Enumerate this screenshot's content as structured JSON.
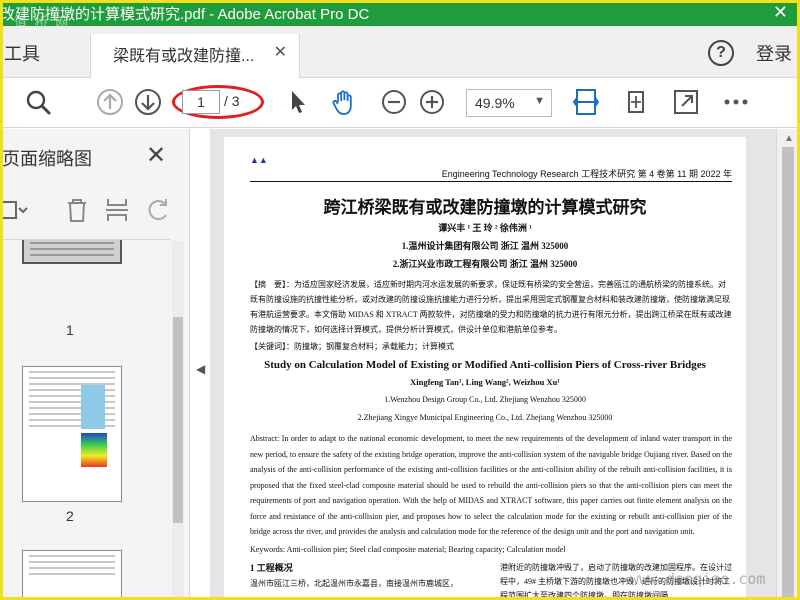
{
  "window": {
    "title": "改建防撞墩的计算模式研究.pdf - Adobe Acrobat Pro DC",
    "watermark": "道 桥 网"
  },
  "tabs": {
    "tools_label": "工具",
    "doc_tab_label": "梁既有或改建防撞...",
    "login_label": "登录"
  },
  "toolbar": {
    "current_page": "1",
    "total_pages": "/ 3",
    "zoom": "49.9%"
  },
  "thumbnail_pane": {
    "title": "页面缩略图",
    "pages": [
      {
        "number": "1"
      },
      {
        "number": "2"
      }
    ]
  },
  "document": {
    "journal_header": "Engineering Technology Research  工程技术研究  第 4 卷第 11 期 2022 年",
    "cn_title": "跨江桥梁既有或改建防撞墩的计算模式研究",
    "cn_authors": "谭兴丰 ¹   王   玲 ²   徐伟洲 ¹",
    "cn_aff1": "1.温州设计集团有限公司  浙江  温州 325000",
    "cn_aff2": "2.浙江兴业市政工程有限公司  浙江  温州  325000",
    "cn_abstract": "【摘　要】：为适应国家经济发展，适应新时期内河水运发展的新要求，保证既有桥梁的安全营运，完善瓯江的通航桥梁的防撞系统。对既有防撞设施的抗撞性能分析，或对改建的防撞设施抗撞能力进行分析，提出采用固定式钢覆复合材料和装改建防撞墩，使防撞墩满足现有港航运营要求。本文借助 MIDAS 和 XTRACT 两款软件，对防撞墩的受力和防撞墩的抗力进行有限元分析，提出跨江桥梁在既有或改建防撞墩的情况下，如何选择计算模式，提供分析计算模式，供设计单位和港航单位参考。",
    "cn_keywords": "【关键词】：防撞墩；钢覆复合材料；承载能力；计算模式",
    "en_title": "Study on Calculation Model of Existing or Modified Anti-collision Piers of Cross-river Bridges",
    "en_authors": "Xingfeng Tan¹, Ling Wang², Weizhou Xu¹",
    "en_aff1": "1.Wenzhou Design Group Co., Ltd. Zhejiang Wenzhou 325000",
    "en_aff2": "2.Zhejiang Xingye Municipal Engineering Co., Ltd. Zhejiang Wenzhou 325000",
    "en_abstract": "Abstract: In order to adapt to the national economic development, to meet the new requirements of the development of inland water transport in the new period, to ensure the safety of the existing bridge operation, improve the anti-collision system of the navigable bridge Oujiang river. Based on the analysis of the anti-collision performance of the existing anti-collision facilities or the anti-collision ability of the rebuilt anti-collision facilities, it is proposed that the fixed steel-clad composite material should be used to rebuild the anti-collision piers so that the anti-collision piers can meet the requirements of port and navigation operation. With the help of MIDAS and XTRACT software, this paper carries out finite element analysis on the force and resistance of the anti-collision pier, and proposes how to select the calculation mode for the existing or rebuilt anti-collision pier of the bridge across the river, and provides the analysis and calculation mode for the reference of the design unit and the port and navigation unit.",
    "en_keywords": "Keywords: Anti-collision pier; Steel clad composite material; Bearing capacity; Calculation model",
    "section1": "1  工程概况",
    "col1_text": "温州市瓯江三桥，北起温州市永嘉县，南接温州市鹿城区，",
    "col2_text": "港附近的防撞墩冲毁了，启动了防撞墩的改建加固程序。在设计过程中，49# 主桥墩下游的防撞墩也冲毁，进行的防撞墩设计时将工程范围扩大至改建四个防撞墩，即在防撞墩间隔..."
  },
  "bottom_watermark": "www.daoqiao.com"
}
